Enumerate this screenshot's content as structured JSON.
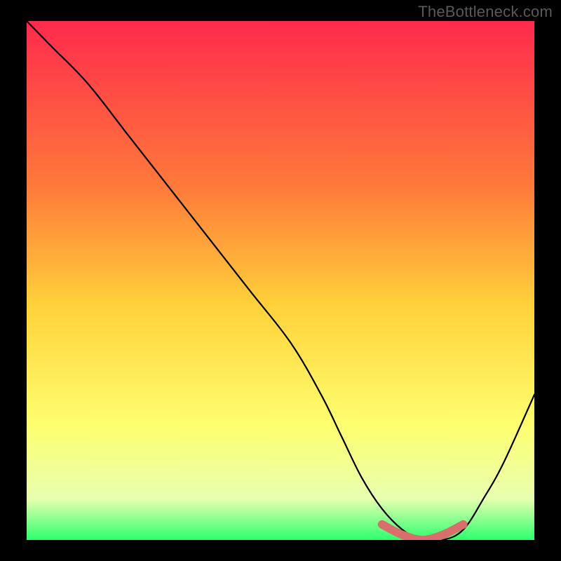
{
  "watermark": "TheBottleneck.com",
  "colors": {
    "frame": "#000000",
    "gradient_top": "#ff2a4d",
    "gradient_mid1": "#ff7a3a",
    "gradient_mid2": "#ffd23a",
    "gradient_mid3": "#feff70",
    "gradient_mid4": "#e8ffb0",
    "gradient_bottom": "#2eff6e",
    "curve": "#000000",
    "highlight": "#d86f6a"
  },
  "chart_data": {
    "type": "line",
    "title": "",
    "xlabel": "",
    "ylabel": "",
    "xlim": [
      0,
      100
    ],
    "ylim": [
      0,
      100
    ],
    "series": [
      {
        "name": "bottleneck-curve",
        "x": [
          0,
          5,
          12,
          20,
          28,
          36,
          44,
          52,
          58,
          62,
          66,
          70,
          74,
          78,
          82,
          86,
          90,
          94,
          100
        ],
        "y": [
          100,
          95,
          88,
          78,
          68,
          58,
          48,
          38,
          28,
          20,
          12,
          6,
          2,
          0,
          0,
          2,
          8,
          15,
          28
        ]
      },
      {
        "name": "optimal-band",
        "x": [
          70,
          74,
          78,
          82,
          86
        ],
        "y": [
          3,
          1,
          0,
          1,
          3
        ]
      }
    ],
    "annotations": []
  }
}
